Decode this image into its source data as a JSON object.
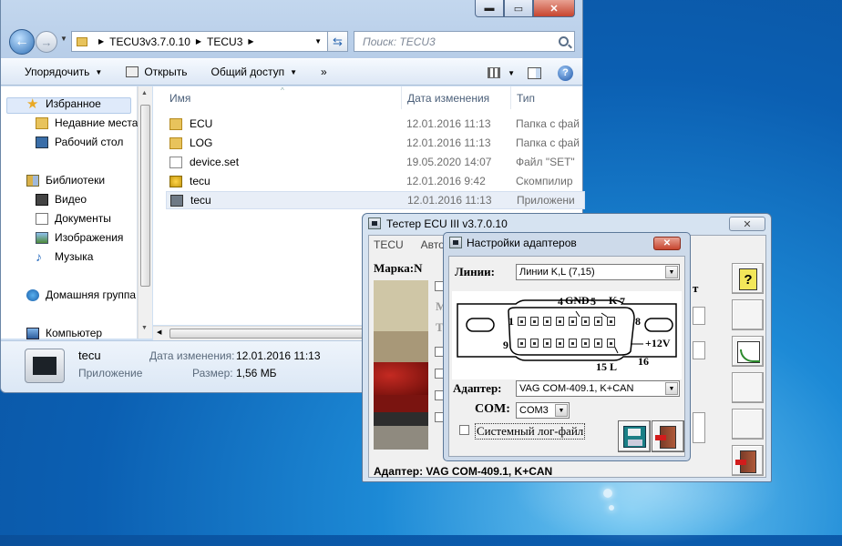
{
  "explorer": {
    "caption": {
      "minimize": "▬",
      "maximize": "▭",
      "close": "✕"
    },
    "breadcrumb": [
      "TECU3v3.7.0.10",
      "TECU3"
    ],
    "search_placeholder": "Поиск: TECU3",
    "toolbar": {
      "organize": "Упорядочить",
      "open": "Открыть",
      "share": "Общий доступ",
      "more": "»"
    },
    "nav": {
      "favorites": "Избранное",
      "recent": "Недавние места",
      "desktop": "Рабочий стол",
      "libraries": "Библиотеки",
      "video": "Видео",
      "documents": "Документы",
      "images": "Изображения",
      "music": "Музыка",
      "homegroup": "Домашняя группа",
      "computer": "Компьютер"
    },
    "columns": {
      "name": "Имя",
      "date": "Дата изменения",
      "type": "Тип"
    },
    "files": [
      {
        "name": "ECU",
        "date": "12.01.2016 11:13",
        "type": "Папка с фай",
        "icon": "folder-icon"
      },
      {
        "name": "LOG",
        "date": "12.01.2016 11:13",
        "type": "Папка с фай",
        "icon": "folder-icon"
      },
      {
        "name": "device.set",
        "date": "19.05.2020 14:07",
        "type": "Файл \"SET\"",
        "icon": "file-icon"
      },
      {
        "name": "tecu",
        "date": "12.01.2016 9:42",
        "type": "Скомпилир",
        "icon": "setup-icon"
      },
      {
        "name": "tecu",
        "date": "12.01.2016 11:13",
        "type": "Приложени",
        "icon": "app-icon"
      }
    ],
    "details": {
      "name": "tecu",
      "type": "Приложение",
      "modified_label": "Дата изменения:",
      "modified_value": "12.01.2016 11:13",
      "size_label": "Размер:",
      "size_value": "1,56 МБ"
    }
  },
  "tester": {
    "title": "Тестер ECU III v3.7.0.10",
    "close": "✕",
    "menu": [
      "TECU",
      "Авто"
    ],
    "marka_label": "Марка:N",
    "partial_letters": [
      "М",
      "Т"
    ],
    "partial_t": "т",
    "help_button": "?",
    "bottom_adapter": "Адаптер: VAG COM-409.1, K+CAN"
  },
  "settings": {
    "title": "Настройки адаптеров",
    "close": "✕",
    "lines_label": "Линии:",
    "lines_value": "Линии K,L (7,15)",
    "pin_labels": {
      "p4": "4",
      "gnd": "GND",
      "p5": "5",
      "k": "K",
      "p7": "7",
      "p1": "1",
      "p8": "8",
      "p9": "9",
      "p15l": "15 L",
      "p16": "16",
      "plus12v": "+12V"
    },
    "adapter_label": "Адаптер:",
    "adapter_value": "VAG COM-409.1, K+CAN",
    "com_label": "COM:",
    "com_value": "COM3",
    "syslog_label": "Системный лог-файл"
  }
}
